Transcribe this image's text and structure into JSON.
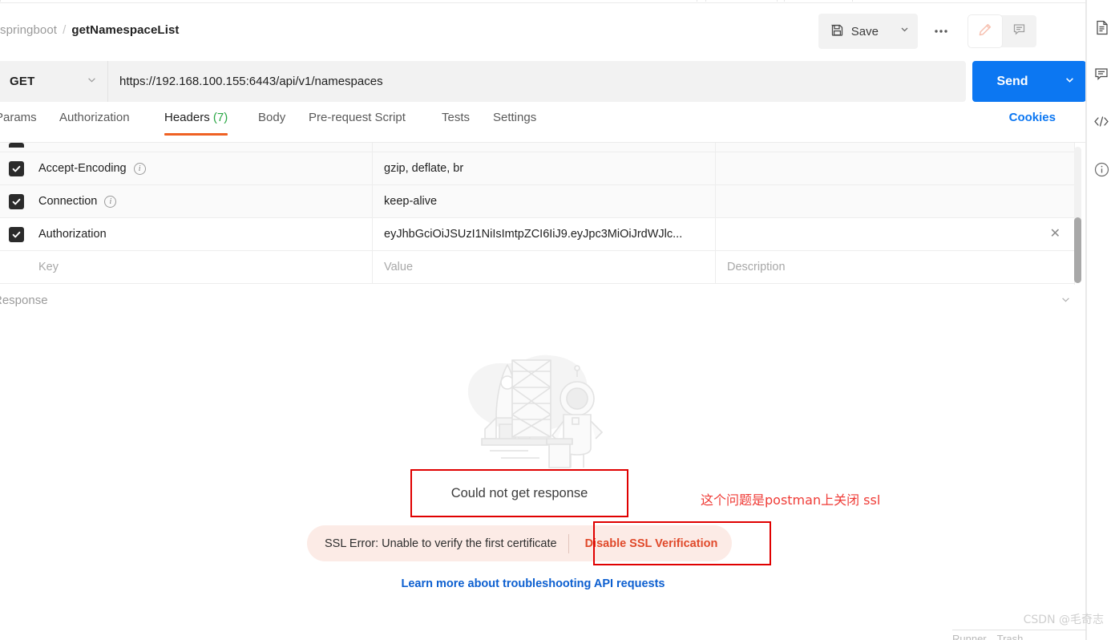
{
  "breadcrumb": {
    "collection": "springboot",
    "separator": "/",
    "request_name": "getNamespaceList"
  },
  "toolbar": {
    "save_label": "Save",
    "save_icon": "floppy-disk-icon",
    "save_caret_icon": "chevron-down-icon",
    "more_icon": "ellipsis-icon",
    "edit_icon": "pencil-icon",
    "comment_icon": "comment-icon"
  },
  "request": {
    "method": "GET",
    "method_caret_icon": "chevron-down-icon",
    "url": "https://192.168.100.155:6443/api/v1/namespaces",
    "send_label": "Send",
    "send_caret_icon": "chevron-down-icon"
  },
  "tabs": [
    {
      "label": "Params",
      "count": "",
      "selected": false
    },
    {
      "label": "Authorization",
      "count": "",
      "selected": false
    },
    {
      "label": "Headers",
      "count": "(7)",
      "selected": true
    },
    {
      "label": "Body",
      "count": "",
      "selected": false
    },
    {
      "label": "Pre-request Script",
      "count": "",
      "selected": false
    },
    {
      "label": "Tests",
      "count": "",
      "selected": false
    },
    {
      "label": "Settings",
      "count": "",
      "selected": false
    }
  ],
  "cookies_label": "Cookies",
  "headers_table": {
    "columns": [
      "Key",
      "Value",
      "Description"
    ],
    "rows": [
      {
        "checked": true,
        "key": "Accept-Encoding",
        "has_info": true,
        "value": "gzip, deflate, br",
        "description": "",
        "deletable": false
      },
      {
        "checked": true,
        "key": "Connection",
        "has_info": true,
        "value": "keep-alive",
        "description": "",
        "deletable": false
      },
      {
        "checked": true,
        "key": "Authorization",
        "has_info": false,
        "value": "eyJhbGciOiJSUzI1NiIsImtpZCI6IiJ9.eyJpc3MiOiJrdWJlc...",
        "description": "",
        "deletable": true
      }
    ],
    "new_row": {
      "key_placeholder": "Key",
      "value_placeholder": "Value",
      "description_placeholder": "Description"
    },
    "delete_icon": "close-icon",
    "info_icon": "info-icon"
  },
  "response": {
    "label": "Response",
    "collapse_icon": "chevron-down-icon",
    "illustration": "rocket-astronaut-illustration",
    "error_title": "Could not get response",
    "ssl_error_message": "SSL Error: Unable to verify the first certificate",
    "ssl_action_label": "Disable SSL Verification",
    "learn_more": "Learn more about troubleshooting API requests"
  },
  "annotation": {
    "text": "这个问题是postman上关闭 ssl",
    "color": "#ef3b36",
    "highlight_color": "#e00000"
  },
  "right_rail": [
    {
      "icon": "document-icon",
      "name": "documentation"
    },
    {
      "icon": "comment-icon",
      "name": "comments"
    },
    {
      "icon": "code-icon",
      "name": "code-snippet"
    },
    {
      "icon": "info-icon",
      "name": "info"
    }
  ],
  "status_bar": {
    "runner": "Runner",
    "trash": "Trash"
  },
  "watermark": "CSDN @毛奇志",
  "colors": {
    "accent_blue": "#0c77f2",
    "tab_underline": "#ef6123",
    "count_green": "#2aa745",
    "error_red": "#e0492a",
    "annotation_red": "#e00000"
  }
}
